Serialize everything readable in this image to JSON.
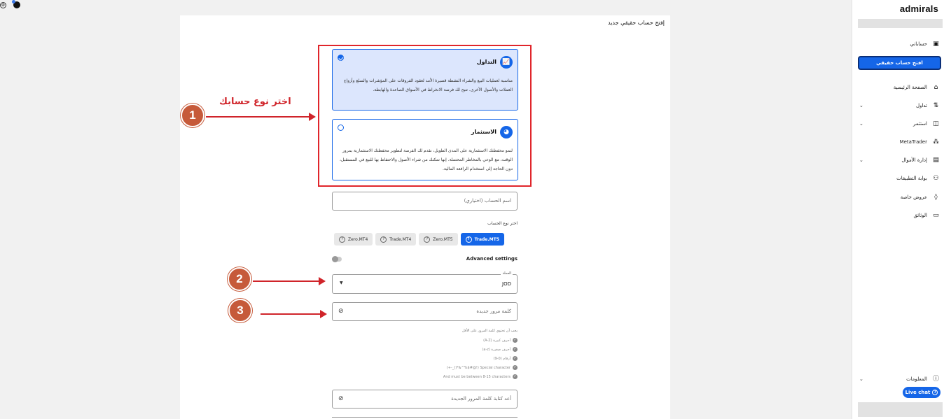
{
  "colors": {
    "accent": "#1566e8",
    "annotation": "#d0242a",
    "annotation_circle": "#c65a3a",
    "selected_bg": "#dce6fd"
  },
  "sidebar": {
    "logo": "admirals",
    "items": [
      {
        "label": "حساباتي",
        "icon": "wallet-icon"
      },
      {
        "label": "الصفحة الرئيسية",
        "icon": "home-icon"
      },
      {
        "label": "تداول",
        "icon": "candles-icon"
      },
      {
        "label": "استثمر",
        "icon": "chart-icon"
      },
      {
        "label": "MetaTrader",
        "icon": "metatrader-icon"
      },
      {
        "label": "إدارة الأموال",
        "icon": "wallet-icon"
      },
      {
        "label": "بوابة التطبيقات",
        "icon": "apps-icon"
      },
      {
        "label": "عروض خاصة",
        "icon": "fire-icon"
      },
      {
        "label": "الوثائق",
        "icon": "document-icon"
      },
      {
        "label": "المعلومات",
        "icon": "info-icon"
      }
    ],
    "open_account_button": "افتح حساب حقيقي",
    "live_chat": "Live chat"
  },
  "page": {
    "title": "إفتح حساب حقيقي جديد",
    "account_types": [
      {
        "title": "التداول",
        "description": "مناسبة لعمليات البيع والشراء النشطة قصيرة الأمد لعقود الفروقات على المؤشرات والسلع وأزواج العملات والأصول الأخرى. تتيح لك فرصة الانخراط في الأسواق الصاعدة والهابطة.",
        "selected": true,
        "icon": "trend-chart-icon"
      },
      {
        "title": "الاستثمار",
        "description": "لنمو محفظتك الاستثمارية على المدى الطويل، نقدم لك الفرصة لتطوير محفظتك الاستثمارية بمرور الوقت، مع الوعي بالمخاطر المحتملة. إنها تمكنك من شراء الأصول والاحتفاظ بها للبيع في المستقبل، دون الحاجة إلى استخدام الرافعة المالية.",
        "selected": false,
        "icon": "pie-chart-icon"
      }
    ],
    "account_name_placeholder": "اسم الحساب (اختياري)",
    "choose_account_label": "اختر نوع الحساب",
    "account_pills": [
      "Trade.MT5",
      "Zero.MT5",
      "Trade.MT4",
      "Zero.MT4"
    ],
    "advanced_settings": "Advanced settings",
    "currency_label": "العملة",
    "currency_value": "JOD",
    "new_password_placeholder": "كلمة مرور جديدة",
    "password_rules_head": "يجب أن تحتوي كلمة المرور على الأقل",
    "password_rules": [
      "أحرف كبيرة (A-Z)",
      "أحرف صغيرة (a-z)",
      "أرقام (0-9)",
      "Special character (!@#$%^&*()_-+)",
      "And must be between 8-15 characters"
    ],
    "repeat_password_placeholder": "أعد كتابة كلمة المرور الجديدة"
  },
  "annotations": {
    "step1_text": "اختر نوع حسابك",
    "steps": [
      "1",
      "2",
      "3"
    ]
  }
}
